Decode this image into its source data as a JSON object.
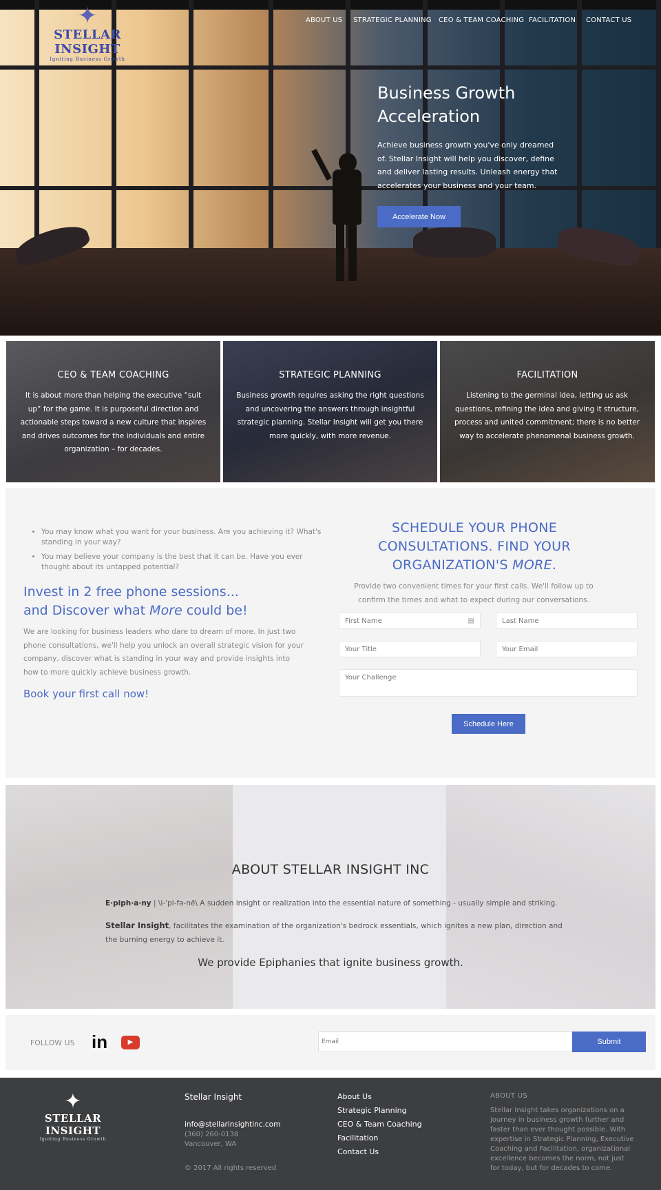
{
  "brand": {
    "name": "STELLAR INSIGHT",
    "tagline": "Igniting Business Growth"
  },
  "nav": [
    "ABOUT US",
    "STRATEGIC PLANNING",
    "CEO & TEAM COACHING",
    "FACILITATION",
    "CONTACT US"
  ],
  "hero": {
    "title": "Business Growth Acceleration",
    "text": "Achieve business growth you've only dreamed of. Stellar Insight will help you discover, define and deliver lasting results. Unleash energy that accelerates your business and your team.",
    "button": "Accelerate Now"
  },
  "services": [
    {
      "title": "CEO & TEAM COACHING",
      "text": "It is about more than helping the executive “suit up” for the game. It is purposeful direction and actionable steps toward a new culture that inspires and drives outcomes for the individuals and entire organization – for decades."
    },
    {
      "title": "STRATEGIC PLANNING",
      "text": "Business growth requires asking the right questions and uncovering the answers through insightful strategic planning. Stellar Insight will get you there more quickly, with more revenue."
    },
    {
      "title": "FACILITATION",
      "text": "Listening to the germinal idea, letting us ask questions, refining the idea and giving it structure, process and united commitment; there is no better way to accelerate phenomenal business growth."
    }
  ],
  "consult": {
    "bullets": [
      "You may know what you want for your business. Are you achieving it? What's standing in your way?",
      "You may believe your company is the best that it can be. Have you ever thought about its untapped potential?"
    ],
    "heading_line1": "Invest in 2 free phone sessions...",
    "heading_line2_pre": "and Discover what ",
    "heading_line2_em": "More",
    "heading_line2_post": " could be!",
    "paragraph": "We are looking for business leaders who dare to dream of more. In just two phone consultations, we'll help you unlock an overall strategic vision for your company, discover what is standing in your way and provide insights into how to more quickly achieve business growth.",
    "cta": "Book your first call now!",
    "form_title_1": "SCHEDULE YOUR PHONE",
    "form_title_2": "CONSULTATIONS. FIND YOUR",
    "form_title_3_pre": "ORGANIZATION'S ",
    "form_title_3_em": "MORE",
    "form_title_3_post": ".",
    "form_intro": "Provide two convenient times for your first calls. We'll follow up to confirm the times and what to expect during our conversations.",
    "first_name": "First Name",
    "last_name": "Last Name",
    "title": "Your Title",
    "email": "Your Email",
    "challenge": "Your Challenge",
    "submit": "Schedule Here"
  },
  "about": {
    "heading": "ABOUT STELLAR INSIGHT INC",
    "term": "E·piph·a·ny",
    "definition": " | \\i-ˈpi-fə-nē\\ A sudden insight or realization into the essential nature of something - usually simple and striking.",
    "company": "Stellar Insight",
    "company_text": ", facilitates the examination of the organization's bedrock essentials, which ignites a new plan, direction and the burning energy to achieve it.",
    "tagline": "We provide Epiphanies that ignite business growth."
  },
  "follow": {
    "label": "FOLLOW US",
    "email_placeholder": "Email",
    "submit": "Submit"
  },
  "footer": {
    "name": "Stellar Insight",
    "email": "info@stellarinsightinc.com",
    "phone": "(360) 260-0138",
    "city": "Vancouver, WA",
    "copyright": "© 2017 All rights reserved",
    "links": [
      "About Us",
      "Strategic Planning",
      "CEO & Team Coaching",
      "Facilitation",
      "Contact Us"
    ],
    "about_title": "ABOUT US",
    "about_text": "Stellar Insight takes organizations on a journey in business growth further and faster than ever thought possible. With expertise in Strategic Planning, Executive Coaching and Facilitation, organizational excellence becomes the norm, not just for today, but for decades to come."
  },
  "colors": {
    "accent": "#4a6bc6",
    "footer": "#3d3e40",
    "section_bg": "#f4f4f4"
  }
}
